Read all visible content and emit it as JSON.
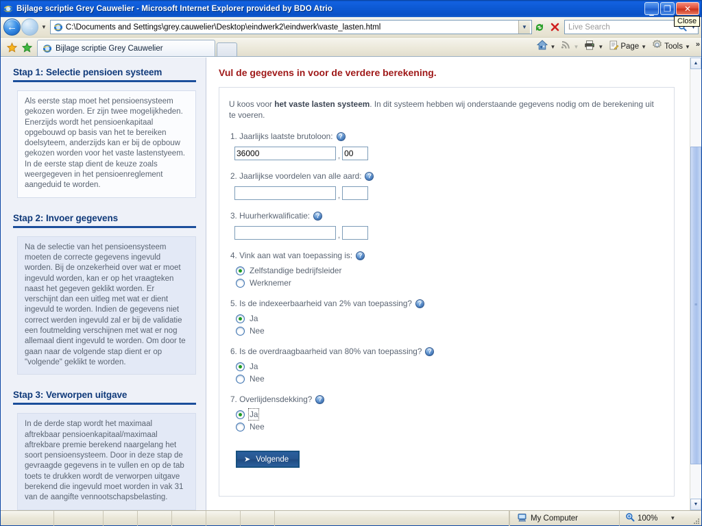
{
  "window": {
    "title": "Bijlage scriptie Grey Cauwelier - Microsoft Internet Explorer provided by BDO Atrio",
    "minimize_label": "_",
    "maximize_label": "❐",
    "close_label": "✕",
    "close_tooltip": "Close"
  },
  "browser": {
    "back_glyph": "←",
    "forward_glyph": "→",
    "history_caret": "▼",
    "url": "C:\\Documents and Settings\\grey.cauwelier\\Desktop\\eindwerk2\\eindwerk\\vaste_lasten.html",
    "url_dropdown_caret": "▼",
    "refresh_glyph": "↻",
    "stop_glyph": "✕",
    "search_placeholder": "Live Search",
    "search_glyph": "⚲",
    "search_caret": "▼",
    "tab_label": "Bijlage scriptie Grey Cauwelier",
    "toolbar": {
      "home_label": "",
      "feeds_label": "",
      "print_label": "",
      "page_label": "Page",
      "tools_label": "Tools",
      "caret": "▼",
      "overflow": "»"
    }
  },
  "sidebar": {
    "steps": [
      {
        "heading": "Stap 1: Selectie pensioen systeem",
        "body": "Als eerste stap moet het pensioensysteem gekozen worden. Er zijn twee mogelijkheden. Enerzijds wordt het pensioenkapitaal opgebouwd op basis van het te bereiken doelsyteem, anderzijds kan er bij de opbouw gekozen worden voor het vaste lastenstyeem. In de eerste stap dient de keuze zoals weergegeven in het pensioenreglement aangeduid te worden."
      },
      {
        "heading": "Stap 2: Invoer gegevens",
        "body": "Na de selectie van het pensioensysteem moeten de correcte gegevens ingevuld worden. Bij de onzekerheid over wat er moet ingevuld worden, kan er op het vraagteken naast het gegeven geklikt worden. Er verschijnt dan een uitleg met wat er dient ingevuld te worden. Indien de gegevens niet correct werden ingevuld zal er bij de validatie een foutmelding verschijnen met wat er nog allemaal dient ingevuld te worden. Om door te gaan naar de volgende stap dient er op \"volgende\" geklikt te worden."
      },
      {
        "heading": "Stap 3: Verworpen uitgave",
        "body": "In de derde stap wordt het maximaal aftrekbaar pensioenkapitaal/maximaal aftrekbare premie berekend naargelang het soort pensioensysteem. Door in deze stap de gevraagde gegevens in te vullen en op de tab toets te drukken wordt de verworpen uitgave berekend die ingevuld moet worden in vak 31 van de aangifte vennootschapsbelasting."
      }
    ]
  },
  "main": {
    "title": "Vul de gegevens in voor de verdere berekening.",
    "intro_before": "U koos voor ",
    "intro_bold": "het vaste lasten systeem",
    "intro_after": ". In dit systeem hebben wij onderstaande gegevens nodig om de berekening uit te voeren.",
    "help_glyph": "?",
    "comma": ",",
    "questions": [
      {
        "label": "1. Jaarlijks laatste brutoloon:",
        "value_major": "36000",
        "value_minor": "00"
      },
      {
        "label": "2. Jaarlijkse voordelen van alle aard:",
        "value_major": "",
        "value_minor": ""
      },
      {
        "label": "3. Huurherkwalificatie:",
        "value_major": "",
        "value_minor": ""
      }
    ],
    "q4": {
      "label": "4. Vink aan wat van toepassing is:",
      "options": [
        {
          "label": "Zelfstandige bedrijfsleider",
          "selected": true
        },
        {
          "label": "Werknemer",
          "selected": false
        }
      ]
    },
    "q5": {
      "label": "5. Is de indexeerbaarheid van 2% van toepassing?",
      "options": [
        {
          "label": "Ja",
          "selected": true
        },
        {
          "label": "Nee",
          "selected": false
        }
      ]
    },
    "q6": {
      "label": "6. Is de overdraagbaarheid van 80% van toepassing?",
      "options": [
        {
          "label": "Ja",
          "selected": true
        },
        {
          "label": "Nee",
          "selected": false
        }
      ]
    },
    "q7": {
      "label": "7. Overlijdensdekking?",
      "options": [
        {
          "label": "Ja",
          "selected": true,
          "focused": true
        },
        {
          "label": "Nee",
          "selected": false
        }
      ]
    },
    "next_button": "Volgende",
    "next_arrow": "➤"
  },
  "scrollbar": {
    "up_glyph": "▲",
    "down_glyph": "▼",
    "grip": "≡"
  },
  "statusbar": {
    "zone": "My Computer",
    "zoom": "100%",
    "zoom_caret": "▼",
    "zoom_glyph": "⚲"
  },
  "colors": {
    "title_red": "#9e1717",
    "heading_navy": "#103a7a",
    "accent_blue": "#1b4e9b",
    "radio_green": "#1f9b22"
  }
}
